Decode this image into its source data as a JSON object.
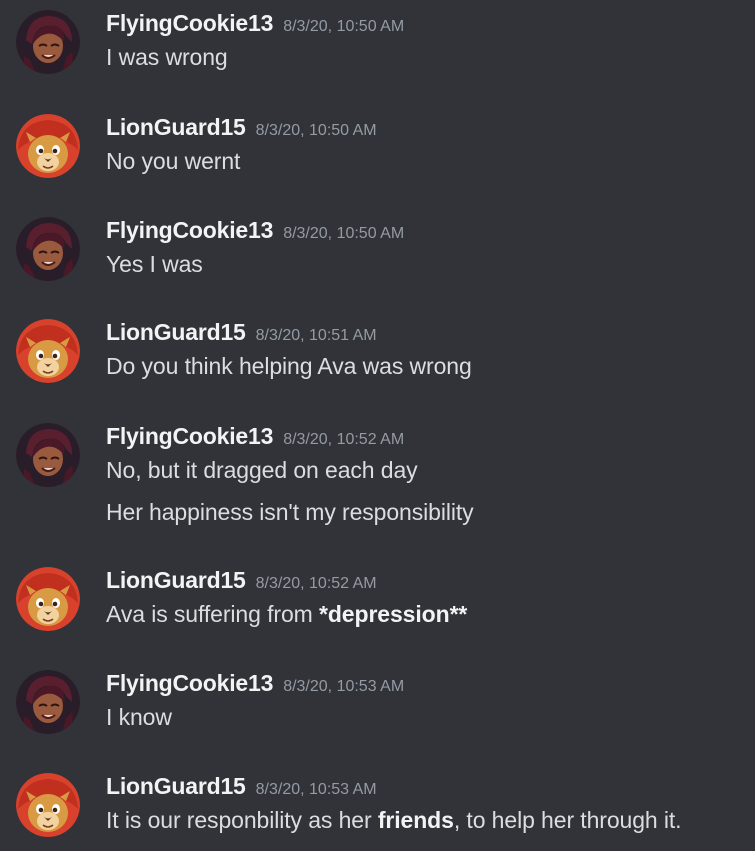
{
  "messages": [
    {
      "author": "FlyingCookie13",
      "avatar": "avatar-flyingcookie",
      "timestamp": "8/3/20, 10:50 AM",
      "lines": [
        [
          "I was wrong"
        ]
      ]
    },
    {
      "author": "LionGuard15",
      "avatar": "avatar-lionguard",
      "timestamp": "8/3/20, 10:50 AM",
      "lines": [
        [
          "No you wernt"
        ]
      ]
    },
    {
      "author": "FlyingCookie13",
      "avatar": "avatar-flyingcookie",
      "timestamp": "8/3/20, 10:50 AM",
      "lines": [
        [
          "Yes I was"
        ]
      ]
    },
    {
      "author": "LionGuard15",
      "avatar": "avatar-lionguard",
      "timestamp": "8/3/20, 10:51 AM",
      "lines": [
        [
          "Do you think helping Ava was wrong"
        ]
      ]
    },
    {
      "author": "FlyingCookie13",
      "avatar": "avatar-flyingcookie",
      "timestamp": "8/3/20, 10:52 AM",
      "lines": [
        [
          "No, but it dragged on each day"
        ],
        [
          "Her happiness isn't my responsibility"
        ]
      ]
    },
    {
      "author": "LionGuard15",
      "avatar": "avatar-lionguard",
      "timestamp": "8/3/20, 10:52 AM",
      "lines": [
        [
          "Ava is suffering from ",
          "*depression",
          "**"
        ]
      ]
    },
    {
      "author": "FlyingCookie13",
      "avatar": "avatar-flyingcookie",
      "timestamp": "8/3/20, 10:53 AM",
      "lines": [
        [
          "I know"
        ]
      ]
    },
    {
      "author": "LionGuard15",
      "avatar": "avatar-lionguard",
      "timestamp": "8/3/20, 10:53 AM",
      "lines": [
        [
          "It is our responbility as her ",
          "friends",
          ", to help her through it."
        ]
      ]
    }
  ]
}
